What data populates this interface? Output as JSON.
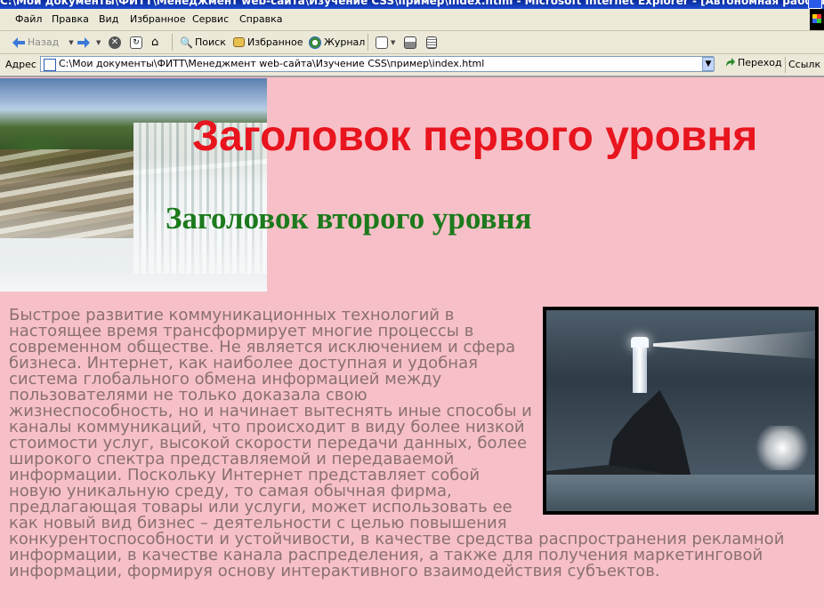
{
  "window": {
    "title": "C:\\Мои документы\\ФИТТ\\Менеджмент web-сайта\\Изучение CSS\\пример\\index.html - Microsoft Internet Explorer - [Автономная работа]"
  },
  "menu": {
    "items": [
      {
        "label": "Файл"
      },
      {
        "label": "Правка"
      },
      {
        "label": "Вид"
      },
      {
        "label": "Избранное"
      },
      {
        "label": "Сервис"
      },
      {
        "label": "Справка"
      }
    ]
  },
  "toolbar": {
    "back_label": "Назад",
    "search_label": "Поиск",
    "favorites_label": "Избранное",
    "history_label": "Журнал"
  },
  "addressbar": {
    "label": "Адрес",
    "url": "C:\\Мои документы\\ФИТТ\\Менеджмент web-сайта\\Изучение CSS\\пример\\index.html",
    "go_label": "Переход",
    "links_label": "Ссылк"
  },
  "page": {
    "h1": "Заголовок первого уровня",
    "h2": "Заголовок второго уровня",
    "paragraph": "Быстрое развитие коммуникационных технологий в настоящее время трансформирует многие процессы в современном обществе. Не является исключением и сфера бизнеса. Интернет, как наиболее доступная и удобная система глобального обмена информацией между пользователями не только доказала свою жизнеспособность, но и начинает вытеснять иные способы и каналы коммуникаций, что происходит в виду более низкой стоимости услуг, высокой скорости передачи данных, более широкого спектра представляемой и передаваемой информации. Поскольку Интернет представляет собой новую уникальную среду, то самая обычная фирма, предлагающая товары или услуги, может использовать ее как новый вид бизнес – деятельности с целью повышения конкурентоспособности и устойчивости, в качестве средства распространения рекламной информации, в качестве канала распределения, а также для получения маркетинговой информации, формируя основу интерактивного взаимодействия субъектов."
  },
  "colors": {
    "page_background": "#f7c0c8",
    "h1_color": "#e8141e",
    "h2_color": "#1c7a1c",
    "text_color": "#8a7070"
  }
}
